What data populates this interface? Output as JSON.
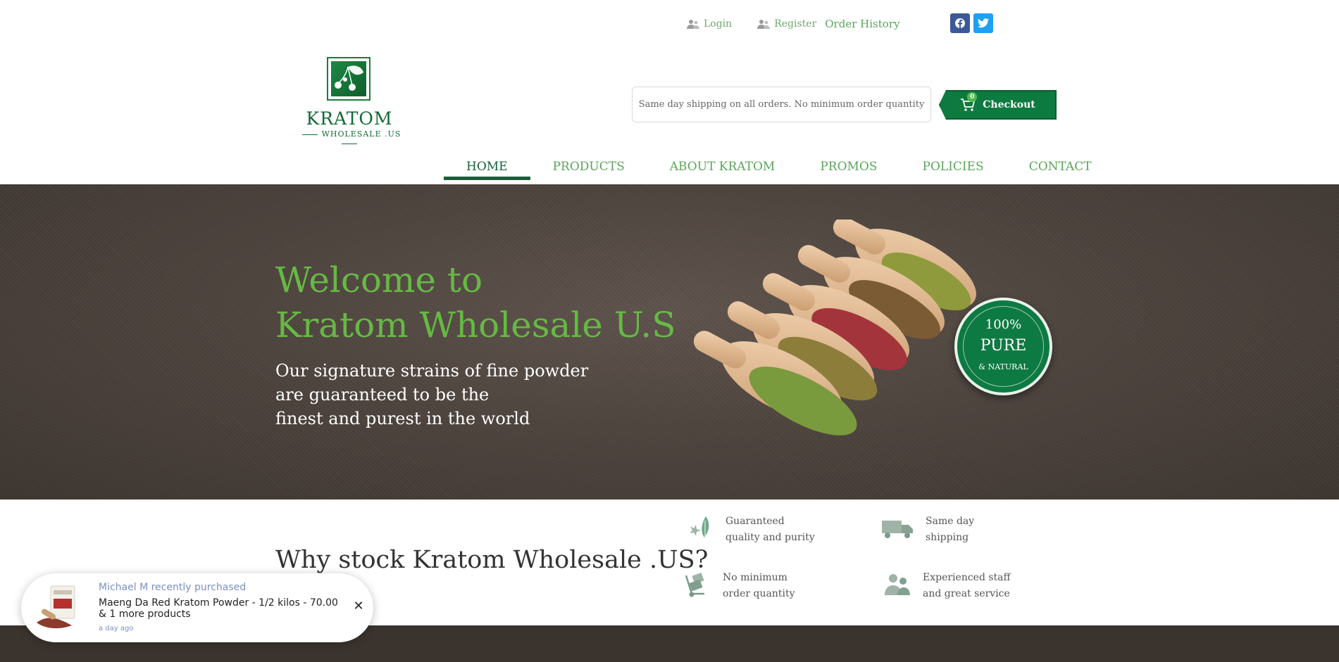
{
  "topbar": {
    "login": "Login",
    "register": "Register",
    "order_history": "Order History",
    "social_icons": [
      "facebook-icon",
      "twitter-icon"
    ]
  },
  "logo": {
    "brand": "KRATOM",
    "sub": "WHOLESALE .US"
  },
  "shipping_notice": "Same day shipping on all orders. No minimum order quantity",
  "checkout": {
    "label": "Checkout",
    "count": "0"
  },
  "nav": [
    "HOME",
    "PRODUCTS",
    "ABOUT KRATOM",
    "PROMOS",
    "POLICIES",
    "CONTACT"
  ],
  "hero": {
    "title_line1": "Welcome to",
    "title_line2": "Kratom Wholesale U.S",
    "tagline": [
      "Our signature strains of fine powder",
      "are guaranteed to be the",
      "finest and purest in the world"
    ],
    "badge": {
      "top": "100%",
      "middle": "PURE",
      "bottom": "& NATURAL"
    }
  },
  "why": {
    "title": "Why stock Kratom Wholesale .US?",
    "features": [
      {
        "icon": "leaf-star-icon",
        "lines": [
          "Guaranteed",
          "quality and purity"
        ]
      },
      {
        "icon": "truck-icon",
        "lines": [
          "Same day",
          "shipping"
        ]
      },
      {
        "icon": "hand-truck-icon",
        "lines": [
          "No minimum",
          "order quantity"
        ]
      },
      {
        "icon": "people-icon",
        "lines": [
          "Experienced staff",
          "and great service"
        ]
      }
    ]
  },
  "popup": {
    "who": "Michael M recently purchased",
    "what": "Maeng Da Red Kratom Powder - 1/2 kilos - 70.00 & 1 more products",
    "when": "a day ago",
    "close": "✕"
  },
  "colors": {
    "brand_green": "#0d7a3f",
    "link_green": "#5aa55a",
    "hero_bg": "#4e443e",
    "title_green": "#66b944"
  }
}
